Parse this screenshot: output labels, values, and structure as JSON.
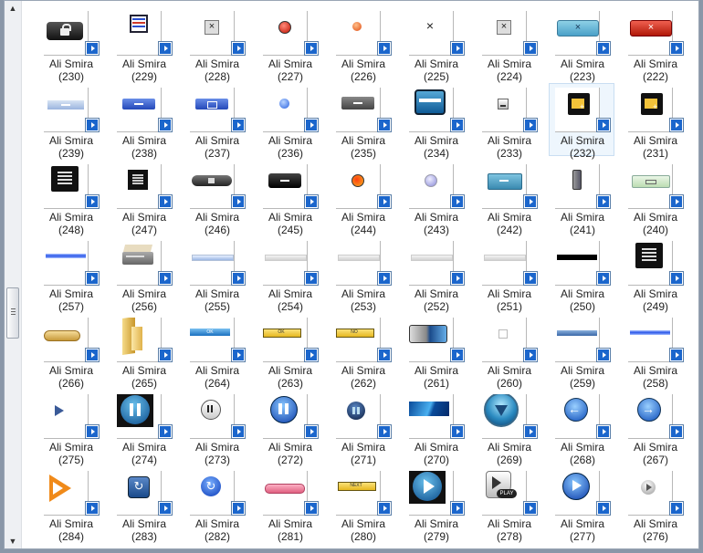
{
  "scrollbar": {
    "up_glyph": "▲",
    "down_glyph": "▼"
  },
  "colors": {
    "overlay": "#1b66cc",
    "selection": "#eef6fd"
  },
  "rows": [
    [
      {
        "author": "Ali Smira",
        "id": "(230)",
        "icon": "lock-button-icon"
      },
      {
        "author": "Ali Smira",
        "id": "(229)",
        "icon": "list-window-icon"
      },
      {
        "author": "Ali Smira",
        "id": "(228)",
        "icon": "close-square-icon"
      },
      {
        "author": "Ali Smira",
        "id": "(227)",
        "icon": "red-dot-icon"
      },
      {
        "author": "Ali Smira",
        "id": "(226)",
        "icon": "orange-dot-icon"
      },
      {
        "author": "Ali Smira",
        "id": "(225)",
        "icon": "x-icon"
      },
      {
        "author": "Ali Smira",
        "id": "(224)",
        "icon": "close-square-icon"
      },
      {
        "author": "Ali Smira",
        "id": "(223)",
        "icon": "blue-close-tab-icon"
      },
      {
        "author": "Ali Smira",
        "id": "(222)",
        "icon": "red-close-tab-icon"
      }
    ],
    [
      {
        "author": "Ali Smira",
        "id": "(239)",
        "icon": "light-minimize-bar-icon"
      },
      {
        "author": "Ali Smira",
        "id": "(238)",
        "icon": "blue-minimize-icon"
      },
      {
        "author": "Ali Smira",
        "id": "(237)",
        "icon": "blue-maximize-icon"
      },
      {
        "author": "Ali Smira",
        "id": "(236)",
        "icon": "blue-dot-icon"
      },
      {
        "author": "Ali Smira",
        "id": "(235)",
        "icon": "gray-minimize-icon"
      },
      {
        "author": "Ali Smira",
        "id": "(234)",
        "icon": "teal-window-icon"
      },
      {
        "author": "Ali Smira",
        "id": "(233)",
        "icon": "small-square-icon"
      },
      {
        "author": "Ali Smira",
        "id": "(232)",
        "icon": "folder-add-icon",
        "selected": true
      },
      {
        "author": "Ali Smira",
        "id": "(231)",
        "icon": "folder-add-icon"
      }
    ],
    [
      {
        "author": "Ali Smira",
        "id": "(248)",
        "icon": "black-list-icon"
      },
      {
        "author": "Ali Smira",
        "id": "(247)",
        "icon": "black-list-small-icon"
      },
      {
        "author": "Ali Smira",
        "id": "(246)",
        "icon": "lock-pill-icon"
      },
      {
        "author": "Ali Smira",
        "id": "(245)",
        "icon": "black-minimize-icon"
      },
      {
        "author": "Ali Smira",
        "id": "(244)",
        "icon": "amber-dot-icon"
      },
      {
        "author": "Ali Smira",
        "id": "(243)",
        "icon": "lavender-dot-icon"
      },
      {
        "author": "Ali Smira",
        "id": "(242)",
        "icon": "teal-minimize-icon"
      },
      {
        "author": "Ali Smira",
        "id": "(241)",
        "icon": "vertical-slider-icon"
      },
      {
        "author": "Ali Smira",
        "id": "(240)",
        "icon": "green-minimize-icon"
      }
    ],
    [
      {
        "author": "Ali Smira",
        "id": "(257)",
        "icon": "blue-line-icon"
      },
      {
        "author": "Ali Smira",
        "id": "(256)",
        "icon": "scanner-icon"
      },
      {
        "author": "Ali Smira",
        "id": "(255)",
        "icon": "light-blue-bar-icon"
      },
      {
        "author": "Ali Smira",
        "id": "(254)",
        "icon": "gray-bar-icon"
      },
      {
        "author": "Ali Smira",
        "id": "(253)",
        "icon": "gray-bar-icon"
      },
      {
        "author": "Ali Smira",
        "id": "(252)",
        "icon": "gray-bar-icon"
      },
      {
        "author": "Ali Smira",
        "id": "(251)",
        "icon": "gray-bar-icon"
      },
      {
        "author": "Ali Smira",
        "id": "(250)",
        "icon": "black-bar-icon"
      },
      {
        "author": "Ali Smira",
        "id": "(249)",
        "icon": "black-list-icon"
      }
    ],
    [
      {
        "author": "Ali Smira",
        "id": "(266)",
        "icon": "gold-pill-icon"
      },
      {
        "author": "Ali Smira",
        "id": "(265)",
        "icon": "folder-open-icon"
      },
      {
        "author": "Ali Smira",
        "id": "(264)",
        "icon": "blue-ok-bar-icon"
      },
      {
        "author": "Ali Smira",
        "id": "(263)",
        "icon": "yellow-ok-bar-icon"
      },
      {
        "author": "Ali Smira",
        "id": "(262)",
        "icon": "yellow-no-bar-icon"
      },
      {
        "author": "Ali Smira",
        "id": "(261)",
        "icon": "glossy-toggle-icon"
      },
      {
        "author": "Ali Smira",
        "id": "(260)",
        "icon": "checkbox-icon"
      },
      {
        "author": "Ali Smira",
        "id": "(259)",
        "icon": "steel-blue-bar-icon"
      },
      {
        "author": "Ali Smira",
        "id": "(258)",
        "icon": "blue-line-icon"
      }
    ],
    [
      {
        "author": "Ali Smira",
        "id": "(275)",
        "icon": "play-small-icon"
      },
      {
        "author": "Ali Smira",
        "id": "(274)",
        "icon": "pause-large-icon"
      },
      {
        "author": "Ali Smira",
        "id": "(273)",
        "icon": "pause-white-icon"
      },
      {
        "author": "Ali Smira",
        "id": "(272)",
        "icon": "pause-blue-icon"
      },
      {
        "author": "Ali Smira",
        "id": "(271)",
        "icon": "pause-dark-icon"
      },
      {
        "author": "Ali Smira",
        "id": "(270)",
        "icon": "blue-gradient-bar-icon"
      },
      {
        "author": "Ali Smira",
        "id": "(269)",
        "icon": "blue-orb-icon"
      },
      {
        "author": "Ali Smira",
        "id": "(268)",
        "icon": "back-arrow-icon"
      },
      {
        "author": "Ali Smira",
        "id": "(267)",
        "icon": "forward-arrow-icon"
      }
    ],
    [
      {
        "author": "Ali Smira",
        "id": "(284)",
        "icon": "orange-play-icon"
      },
      {
        "author": "Ali Smira",
        "id": "(283)",
        "icon": "repeat-square-icon"
      },
      {
        "author": "Ali Smira",
        "id": "(282)",
        "icon": "repeat-circle-icon"
      },
      {
        "author": "Ali Smira",
        "id": "(281)",
        "icon": "pink-pill-icon"
      },
      {
        "author": "Ali Smira",
        "id": "(280)",
        "icon": "yellow-next-bar-icon"
      },
      {
        "author": "Ali Smira",
        "id": "(279)",
        "icon": "play-large-icon"
      },
      {
        "author": "Ali Smira",
        "id": "(278)",
        "icon": "play-badge-icon"
      },
      {
        "author": "Ali Smira",
        "id": "(277)",
        "icon": "play-blue-icon"
      },
      {
        "author": "Ali Smira",
        "id": "(276)",
        "icon": "play-gray-icon"
      }
    ]
  ]
}
